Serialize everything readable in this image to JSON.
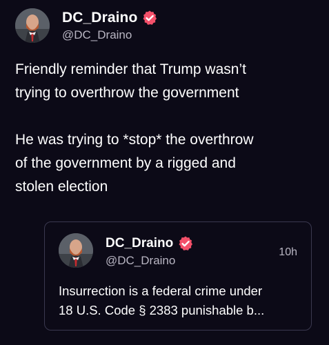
{
  "post": {
    "author": {
      "display_name": "DC_Draino",
      "handle": "@DC_Draino",
      "verified_icon": "verified-badge-icon",
      "badge_color": "#f3506a"
    },
    "paragraphs": [
      [
        "Friendly reminder that Trump wasn’t",
        "trying to overthrow the government"
      ],
      [
        "He was trying to *stop* the overthrow",
        "of the government by a rigged and",
        "stolen election"
      ]
    ]
  },
  "quoted_post": {
    "author": {
      "display_name": "DC_Draino",
      "handle": "@DC_Draino",
      "verified_icon": "verified-badge-icon"
    },
    "timestamp": "10h",
    "text_lines": [
      "Insurrection is a federal crime under",
      "18 U.S. Code § 2383 punishable b..."
    ]
  },
  "colors": {
    "background": "#0c0a17",
    "text_primary": "#ffffff",
    "text_secondary": "#b9b6c3",
    "border": "#3b3950"
  }
}
